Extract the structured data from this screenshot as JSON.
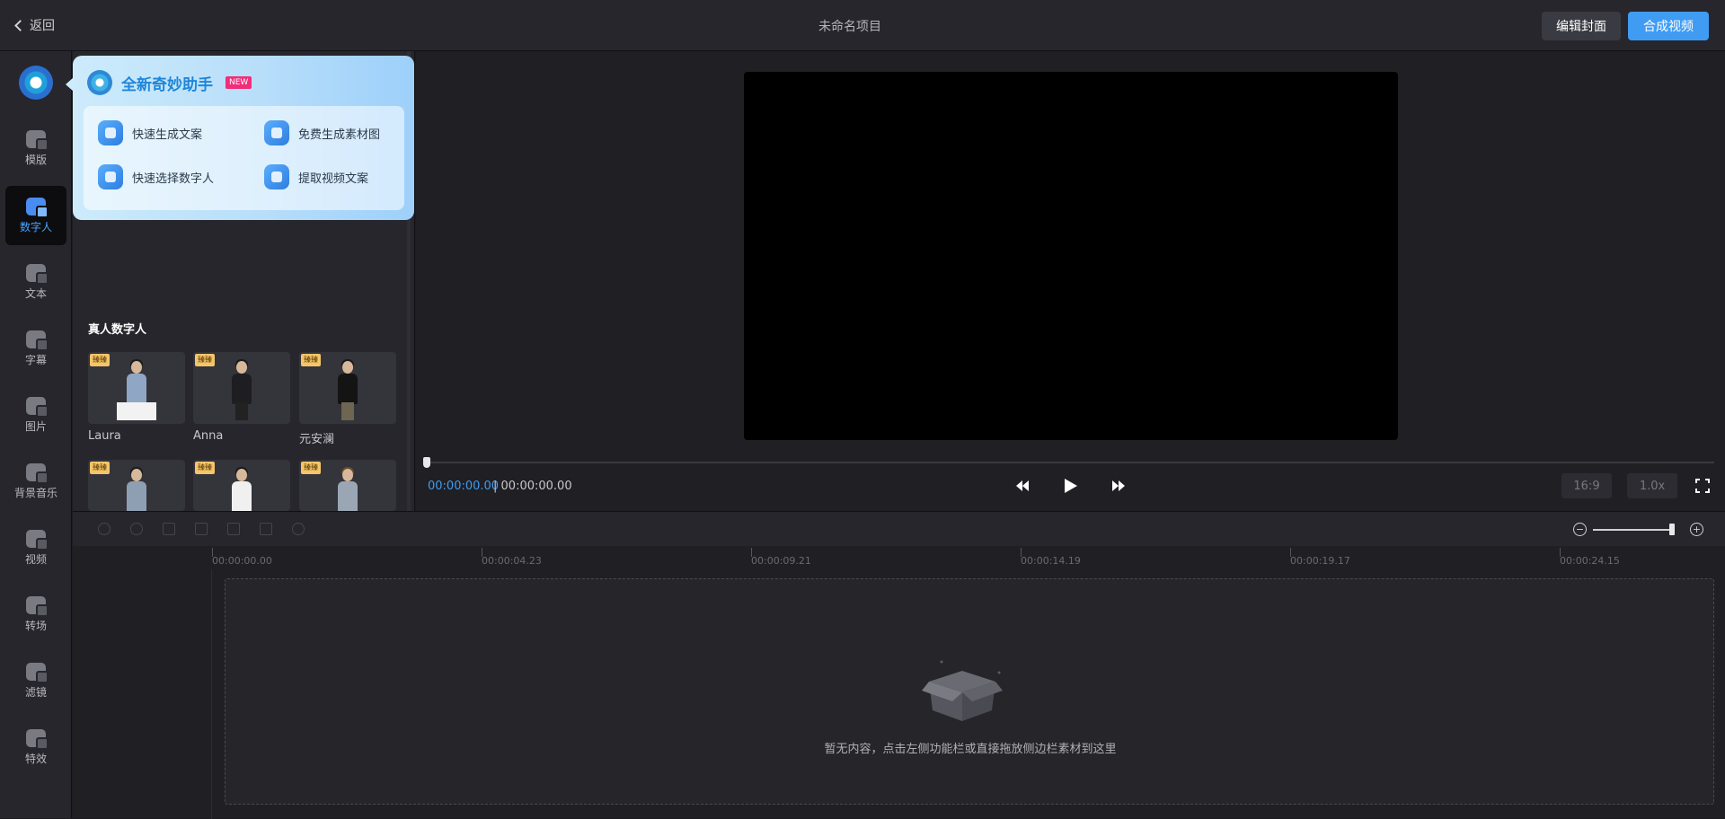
{
  "header": {
    "back_label": "返回",
    "project_title": "未命名项目",
    "edit_cover_label": "编辑封面",
    "compose_video_label": "合成视频",
    "accent_color": "#3f9cf2"
  },
  "sidebar": {
    "items": [
      {
        "label": "模版",
        "icon": "template-icon"
      },
      {
        "label": "数字人",
        "icon": "digital-human-icon",
        "active": true
      },
      {
        "label": "文本",
        "icon": "text-icon"
      },
      {
        "label": "字幕",
        "icon": "subtitle-icon"
      },
      {
        "label": "图片",
        "icon": "image-icon"
      },
      {
        "label": "背景音乐",
        "icon": "music-icon"
      },
      {
        "label": "视频",
        "icon": "video-icon"
      },
      {
        "label": "转场",
        "icon": "transition-icon"
      },
      {
        "label": "滤镜",
        "icon": "filter-icon"
      },
      {
        "label": "特效",
        "icon": "effects-icon"
      }
    ]
  },
  "assistant": {
    "title": "全新奇妙助手",
    "badge": "NEW",
    "items": [
      {
        "label": "快速生成文案"
      },
      {
        "label": "免费生成素材图"
      },
      {
        "label": "快速选择数字人"
      },
      {
        "label": "提取视频文案"
      }
    ]
  },
  "digital_humans": {
    "section_title": "真人数字人",
    "badge": "臻臻",
    "cards": [
      {
        "name": "Laura"
      },
      {
        "name": "Anna"
      },
      {
        "name": "元安澜"
      },
      {
        "name": ""
      },
      {
        "name": ""
      },
      {
        "name": ""
      }
    ]
  },
  "player": {
    "current_time": "00:00:00.00",
    "separator": "|",
    "total_time": "00:00:00.00",
    "ratio": "16:9",
    "speed": "1.0x"
  },
  "timeline": {
    "ticks": [
      "00:00:00.00",
      "00:00:04.23",
      "00:00:09.21",
      "00:00:14.19",
      "00:00:19.17",
      "00:00:24.15"
    ],
    "empty_message": "暂无内容，点击左侧功能栏或直接拖放侧边栏素材到这里"
  }
}
